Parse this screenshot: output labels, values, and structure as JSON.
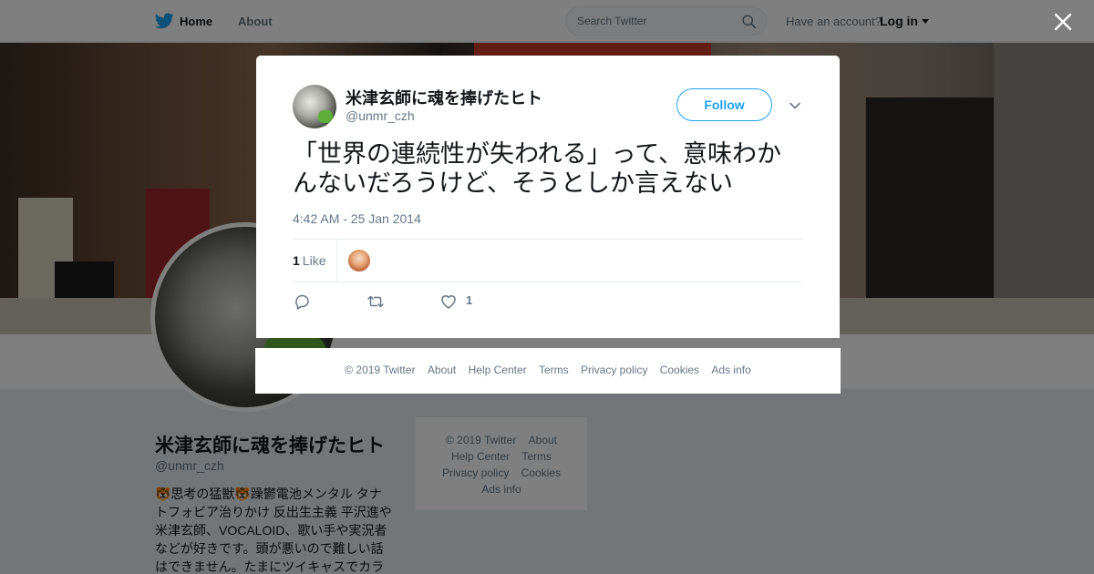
{
  "topnav": {
    "home_label": "Home",
    "about_label": "About",
    "search_placeholder": "Search Twitter",
    "account_question": "Have an account?",
    "login_label": "Log in"
  },
  "profile": {
    "display_name": "米津玄師に魂を捧げたヒト",
    "handle": "@unmr_czh",
    "bio_lines": [
      "🐯思考の猛獣🐯躁鬱電池メンタル タナ",
      "トフォビア治りかけ 反出生主義 平沢進や",
      "米津玄師、VOCALOID、歌い手や実況者",
      "などが好きです。頭が悪いので難しい話",
      "はできません。たまにツイキャスでカラ"
    ]
  },
  "side_footer": {
    "items": [
      "© 2019 Twitter",
      "About",
      "Help Center",
      "Terms",
      "Privacy policy",
      "Cookies",
      "Ads info"
    ]
  },
  "tweet": {
    "author_name": "米津玄師に魂を捧げたヒト",
    "author_handle": "@unmr_czh",
    "follow_label": "Follow",
    "text": "「世界の連続性が失われる」って、意味わかんないだろうけど、そうとしか言えない",
    "timestamp": "4:42 AM - 25 Jan 2014",
    "like_count": "1",
    "like_label": "Like",
    "action_like_count": "1"
  },
  "modal_footer": {
    "items": [
      "© 2019 Twitter",
      "About",
      "Help Center",
      "Terms",
      "Privacy policy",
      "Cookies",
      "Ads info"
    ]
  },
  "colors": {
    "brand_blue": "#1da1f2",
    "secondary_text": "#657786",
    "primary_text": "#14171a"
  },
  "icons": [
    "twitter-bird-icon",
    "search-icon",
    "close-icon",
    "chevron-down-icon",
    "reply-icon",
    "retweet-icon",
    "heart-icon"
  ]
}
